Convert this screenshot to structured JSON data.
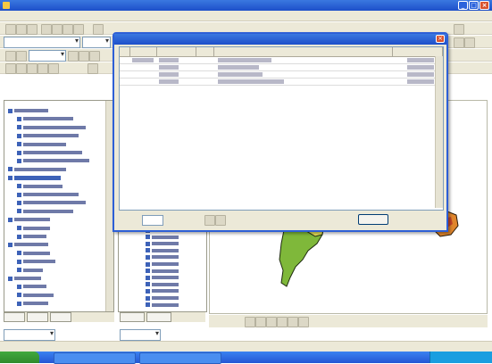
{
  "app": {
    "title": "",
    "window_controls": [
      "_",
      "□",
      "×"
    ]
  },
  "menu": {
    "items": [
      "",
      "",
      "",
      "",
      "",
      "",
      ""
    ]
  },
  "toolbar": {
    "style_combo_value": "",
    "font_combo_value": "",
    "scale_combo_value": ""
  },
  "toc": {
    "tabs": [
      "",
      "",
      ""
    ],
    "layers": [
      {
        "label": ""
      },
      {
        "label": ""
      },
      {
        "label": ""
      },
      {
        "label": ""
      },
      {
        "label": ""
      },
      {
        "label": ""
      },
      {
        "label": ""
      },
      {
        "label": ""
      },
      {
        "label": ""
      },
      {
        "label": ""
      },
      {
        "label": ""
      },
      {
        "label": ""
      },
      {
        "label": ""
      },
      {
        "label": ""
      },
      {
        "label": ""
      },
      {
        "label": ""
      },
      {
        "label": ""
      },
      {
        "label": ""
      },
      {
        "label": ""
      },
      {
        "label": ""
      },
      {
        "label": ""
      },
      {
        "label": ""
      },
      {
        "label": ""
      },
      {
        "label": ""
      }
    ]
  },
  "catalog": {
    "tabs": [
      "",
      ""
    ],
    "items": [
      "",
      "",
      "",
      "",
      "",
      "",
      "",
      "",
      "",
      "",
      "",
      ""
    ]
  },
  "dialog": {
    "title": "",
    "close": "×",
    "columns": [
      "",
      "",
      "",
      "",
      "",
      ""
    ],
    "rows": [
      [
        "",
        "",
        "",
        "",
        "",
        ""
      ],
      [
        "",
        "",
        "",
        "",
        "",
        ""
      ],
      [
        "",
        "",
        "",
        "",
        "",
        ""
      ],
      [
        "",
        "",
        "",
        "",
        "",
        ""
      ]
    ],
    "footer": {
      "record_label": "",
      "record_value": "",
      "show_label": "",
      "count_text": "",
      "options_button": ""
    }
  },
  "statusbar": {
    "coords": ""
  },
  "taskbar": {
    "start_label": "",
    "tasks": [
      "",
      ""
    ],
    "clock": ""
  },
  "colors": {
    "xp_blue": "#1d4fc9",
    "chrome": "#ece9d8",
    "map_green": "#7fb83a",
    "map_yellow": "#e7e15a",
    "map_orange": "#e0862d",
    "selection": "#3d62b8"
  }
}
